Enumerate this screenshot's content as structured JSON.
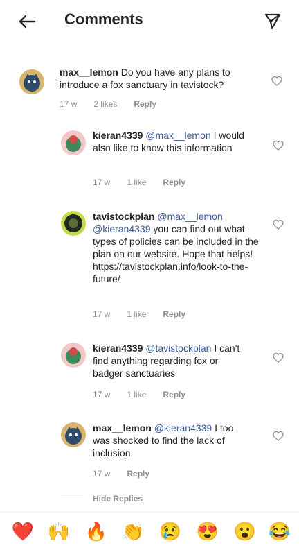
{
  "header": {
    "title": "Comments"
  },
  "comments": [
    {
      "username": "max__lemon",
      "mention": "",
      "text": "Do you have any plans to introduce a fox sanctuary in tavistock?",
      "time": "17 w",
      "likes": "2 likes",
      "reply": "Reply"
    },
    {
      "username": "kieran4339",
      "mention": "@max__lemon",
      "text": "I would also like to know this information",
      "time": "17 w",
      "likes": "1 like",
      "reply": "Reply"
    },
    {
      "username": "tavistockplan",
      "mention": "@max__lemon @kieran4339",
      "text": "you can find out what types of policies can be included in the plan on our website.  Hope that helps! https://tavistockplan.info/look-to-the-future/",
      "time": "17 w",
      "likes": "1 like",
      "reply": "Reply"
    },
    {
      "username": "kieran4339",
      "mention": "@tavistockplan",
      "text": "I can't find anything regarding fox or badger sanctuaries",
      "time": "17 w",
      "likes": "1 like",
      "reply": "Reply"
    },
    {
      "username": "max__lemon",
      "mention": "@kieran4339",
      "text": "I too was shocked to find the lack of inclusion.",
      "time": "17 w",
      "likes": "",
      "reply": "Reply"
    }
  ],
  "hide_replies": "Hide Replies",
  "emojis": [
    "❤️",
    "🙌",
    "🔥",
    "👏",
    "😢",
    "😍",
    "😮",
    "😂"
  ]
}
